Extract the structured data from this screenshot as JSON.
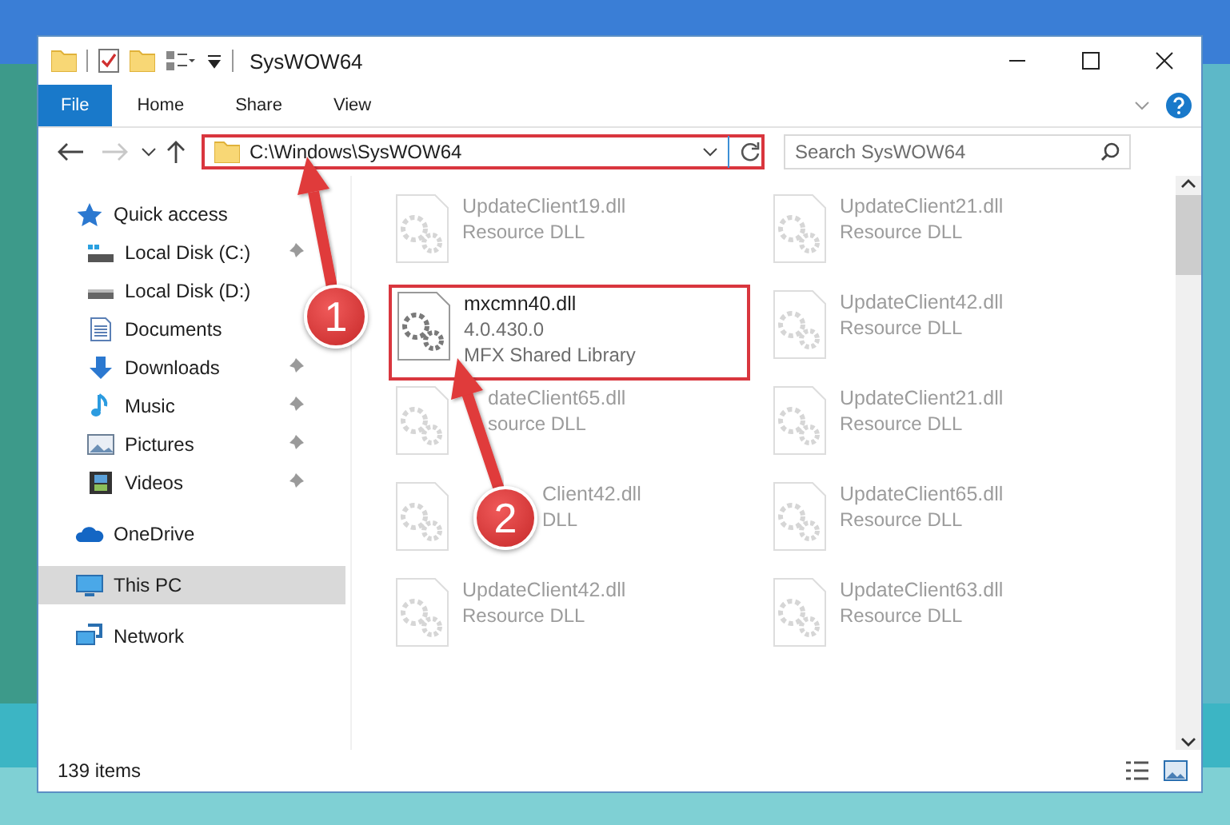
{
  "window": {
    "title": "SysWOW64"
  },
  "ribbon_tabs": [
    {
      "label": "File",
      "selected": true
    },
    {
      "label": "Home",
      "selected": false
    },
    {
      "label": "Share",
      "selected": false
    },
    {
      "label": "View",
      "selected": false
    }
  ],
  "address": {
    "path": "C:\\Windows\\SysWOW64",
    "highlighted": true
  },
  "search": {
    "placeholder": "Search SysWOW64"
  },
  "sidebar": {
    "items": [
      {
        "label": "Quick access",
        "kind": "star",
        "selected": false,
        "children": [
          {
            "label": "Local Disk (C:)",
            "kind": "system-drive",
            "pinned": true,
            "selected": false
          },
          {
            "label": "Local Disk (D:)",
            "kind": "drive",
            "pinned": false,
            "selected": false
          },
          {
            "label": "Documents",
            "kind": "document",
            "pinned": false,
            "selected": false
          },
          {
            "label": "Downloads",
            "kind": "download",
            "pinned": true,
            "selected": false
          },
          {
            "label": "Music",
            "kind": "music",
            "pinned": true,
            "selected": false
          },
          {
            "label": "Pictures",
            "kind": "pictures",
            "pinned": true,
            "selected": false
          },
          {
            "label": "Videos",
            "kind": "videos",
            "pinned": true,
            "selected": false
          }
        ]
      },
      {
        "label": "OneDrive",
        "kind": "cloud",
        "selected": false
      },
      {
        "label": "This PC",
        "kind": "pc",
        "selected": true
      },
      {
        "label": "Network",
        "kind": "network",
        "selected": false
      }
    ]
  },
  "files": [
    {
      "name": "UpdateClient19.dll",
      "description": "Resource DLL",
      "faded": true,
      "highlighted": false
    },
    {
      "name": "UpdateClient21.dll",
      "description": "Resource DLL",
      "faded": true,
      "highlighted": false
    },
    {
      "name": "mxcmn40.dll",
      "version": "4.0.430.0",
      "description": "MFX Shared Library",
      "faded": false,
      "highlighted": true
    },
    {
      "name": "UpdateClient42.dll",
      "description": "Resource DLL",
      "faded": true,
      "highlighted": false
    },
    {
      "name": "dateClient65.dll",
      "description": "source DLL",
      "faded": true,
      "highlighted": false,
      "kind": "hidden-start-arrow"
    },
    {
      "name": "UpdateClient21.dll",
      "description": "Resource DLL",
      "faded": true,
      "highlighted": false
    },
    {
      "name": "Client42.dll",
      "description": "DLL",
      "faded": true,
      "highlighted": false,
      "kind": "hidden-start-badge"
    },
    {
      "name": "UpdateClient65.dll",
      "description": "Resource DLL",
      "faded": true,
      "highlighted": false
    },
    {
      "name": "UpdateClient42.dll",
      "description": "Resource DLL",
      "faded": true,
      "highlighted": false
    },
    {
      "name": "UpdateClient63.dll",
      "description": "Resource DLL",
      "faded": true,
      "highlighted": false
    }
  ],
  "status_bar": {
    "item_count": "139 items"
  },
  "annotations": [
    {
      "label": "1"
    },
    {
      "label": "2"
    }
  ]
}
